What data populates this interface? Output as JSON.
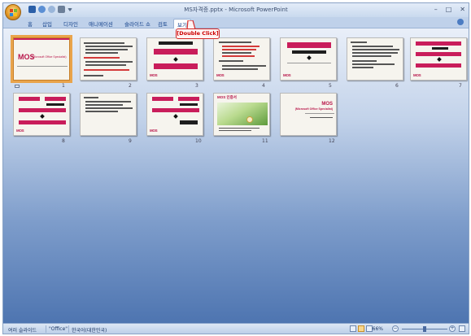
{
  "window": {
    "title": "MS자격증.pptx - Microsoft PowerPoint",
    "controls": [
      "–",
      "□",
      "✕"
    ]
  },
  "quick_access": {
    "icons": [
      "save-icon",
      "undo-icon",
      "redo-icon",
      "print-preview-icon",
      "customize-dropdown-icon"
    ]
  },
  "ribbon": {
    "tabs": [
      {
        "label": "홈",
        "active": false
      },
      {
        "label": "삽입",
        "active": false
      },
      {
        "label": "디자인",
        "active": false
      },
      {
        "label": "애니메이션",
        "active": false
      },
      {
        "label": "슬라이드 쇼",
        "active": false
      },
      {
        "label": "검토",
        "active": false
      },
      {
        "label": "보기",
        "active": true
      }
    ]
  },
  "callout": {
    "text": "[Double Click]"
  },
  "slides": [
    {
      "number": "1",
      "selected": true,
      "title": "MOS",
      "subtitle": "(Microsoft Office Specialist)"
    },
    {
      "number": "2",
      "selected": false
    },
    {
      "number": "3",
      "selected": false
    },
    {
      "number": "4",
      "selected": false
    },
    {
      "number": "5",
      "selected": false
    },
    {
      "number": "6",
      "selected": false
    },
    {
      "number": "7",
      "selected": false
    },
    {
      "number": "8",
      "selected": false
    },
    {
      "number": "9",
      "selected": false
    },
    {
      "number": "10",
      "selected": false
    },
    {
      "number": "11",
      "selected": false,
      "heading": "MOS 인증서"
    },
    {
      "number": "12",
      "selected": false,
      "title": "MOS",
      "subtitle": "(Microsoft Office Specialist)"
    }
  ],
  "statusbar": {
    "view_label": "여러 슬라이드",
    "theme": "\"Office\"",
    "language": "한국어(대한민국)",
    "zoom": "66%"
  },
  "colors": {
    "accent_pink": "#c91d5b",
    "selection": "#e9a44c",
    "callout_red": "#d42a2a"
  }
}
